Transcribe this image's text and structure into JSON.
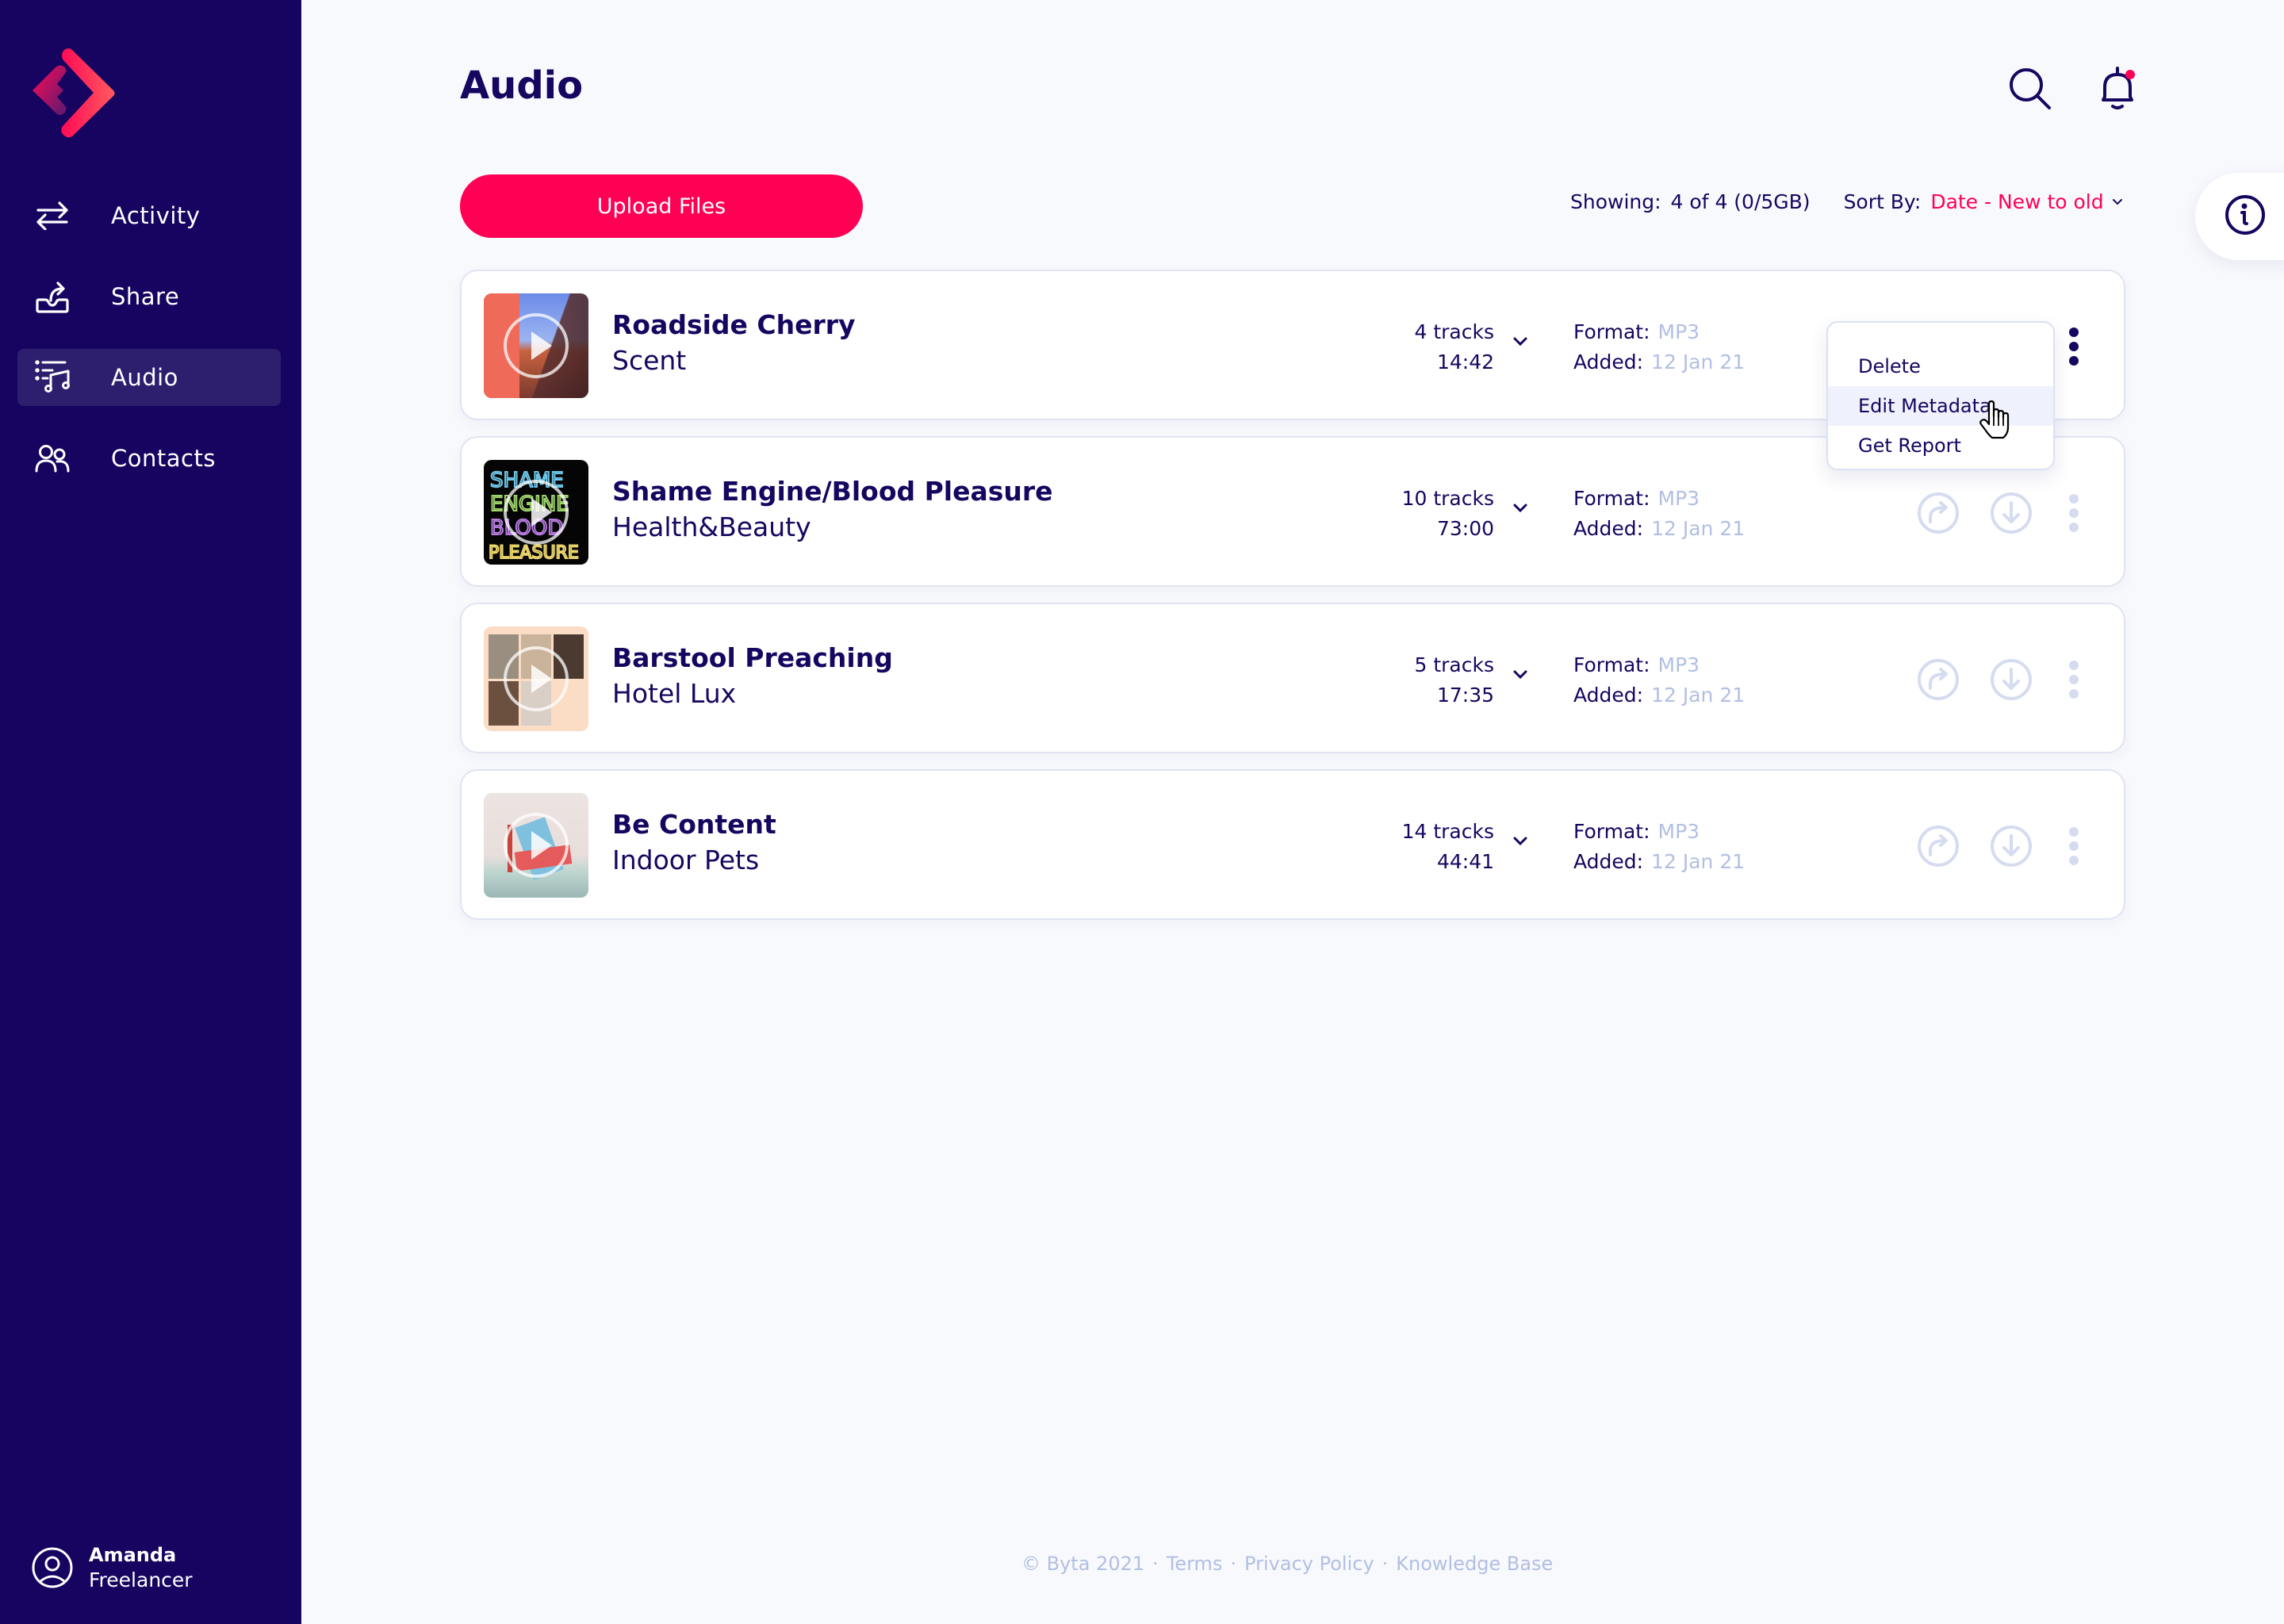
{
  "app": {
    "brand": "Byta",
    "accent_color": "#FF0055",
    "sidebar_color": "#170360",
    "text_color": "#160660",
    "muted_color": "#B2BFE3"
  },
  "sidebar": {
    "items": [
      {
        "label": "Activity",
        "icon": "arrows-swap-icon",
        "active": false
      },
      {
        "label": "Share",
        "icon": "share-tray-icon",
        "active": false
      },
      {
        "label": "Audio",
        "icon": "music-list-icon",
        "active": true
      },
      {
        "label": "Contacts",
        "icon": "users-icon",
        "active": false
      }
    ],
    "user": {
      "name": "Amanda",
      "role": "Freelancer"
    }
  },
  "header": {
    "title": "Audio",
    "icons": [
      "search-icon",
      "bell-icon"
    ],
    "notification_dot": true
  },
  "toolbar": {
    "upload_label": "Upload Files",
    "showing_label": "Showing:",
    "showing_value": "4 of 4 (0/5GB)",
    "sort_label": "Sort By:",
    "sort_value": "Date - New to old"
  },
  "labels": {
    "format": "Format:",
    "added": "Added:"
  },
  "albums": [
    {
      "title": "Roadside Cherry",
      "artist": "Scent",
      "tracks": "4 tracks",
      "duration": "14:42",
      "format": "MP3",
      "added": "12 Jan 21",
      "menu_open": true
    },
    {
      "title": "Shame Engine/Blood Pleasure",
      "artist": "Health&Beauty",
      "tracks": "10 tracks",
      "duration": "73:00",
      "format": "MP3",
      "added": "12 Jan 21",
      "menu_open": false
    },
    {
      "title": "Barstool Preaching",
      "artist": "Hotel Lux",
      "tracks": "5 tracks",
      "duration": "17:35",
      "format": "MP3",
      "added": "12 Jan 21",
      "menu_open": false
    },
    {
      "title": "Be Content",
      "artist": "Indoor Pets",
      "tracks": "14 tracks",
      "duration": "44:41",
      "format": "MP3",
      "added": "12 Jan 21",
      "menu_open": false
    }
  ],
  "context_menu": {
    "items": [
      "Delete",
      "Edit Metadata",
      "Get Report"
    ],
    "hovered": "Edit Metadata"
  },
  "footer": {
    "copyright": "© Byta 2021",
    "separator": "·",
    "links": [
      "Terms",
      "Privacy Policy",
      "Knowledge Base"
    ]
  }
}
